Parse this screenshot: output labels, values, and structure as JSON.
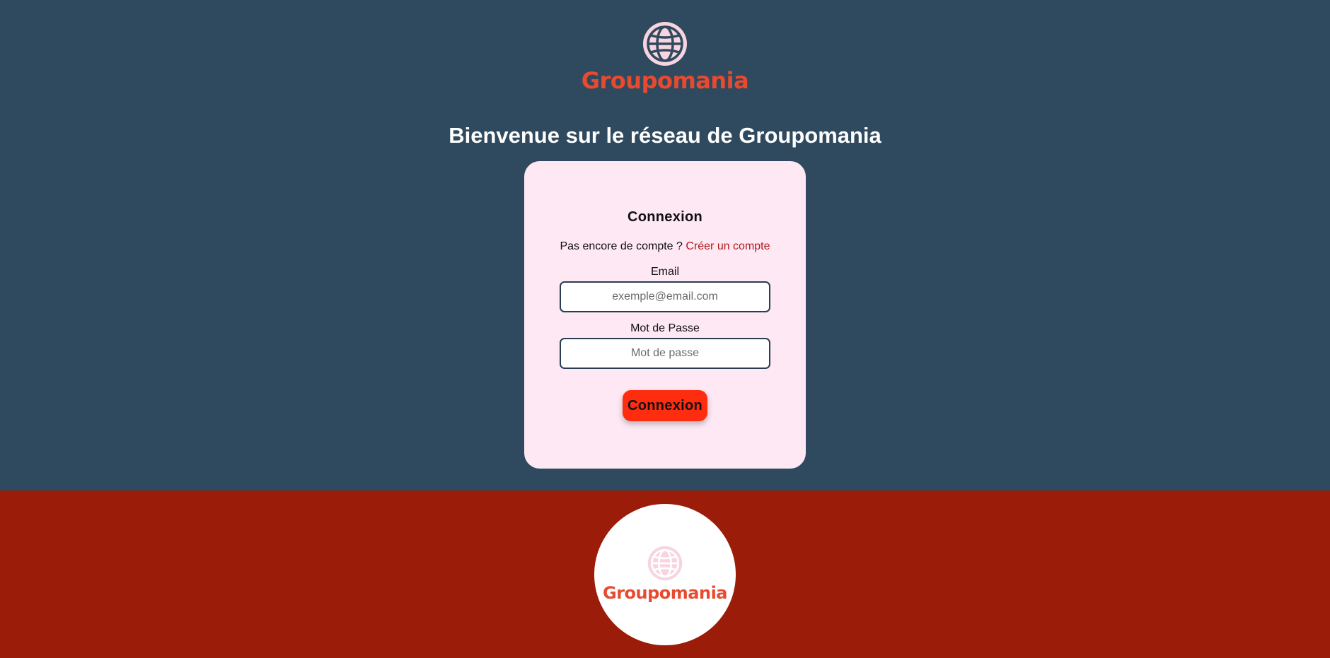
{
  "brand": {
    "name": "Groupomania",
    "logo_icon": "globe-icon",
    "color": "#e84a2f"
  },
  "welcome": {
    "title": "Bienvenue sur le réseau de Groupomania"
  },
  "login": {
    "title": "Connexion",
    "signup_prompt": "Pas encore de compte ?",
    "signup_link": "Créer un compte",
    "email_label": "Email",
    "email_placeholder": "exemple@email.com",
    "email_value": "",
    "password_label": "Mot de Passe",
    "password_placeholder": "Mot de passe",
    "password_value": "",
    "submit_label": "Connexion"
  },
  "footer": {
    "brand_name": "Groupomania",
    "logo_icon": "globe-icon"
  },
  "colors": {
    "background": "#2f4a5e",
    "card": "#fde8f3",
    "accent": "#ff2d0f",
    "footer": "#9b1c08",
    "link": "#b3191b",
    "globe": "#f7d4df"
  }
}
